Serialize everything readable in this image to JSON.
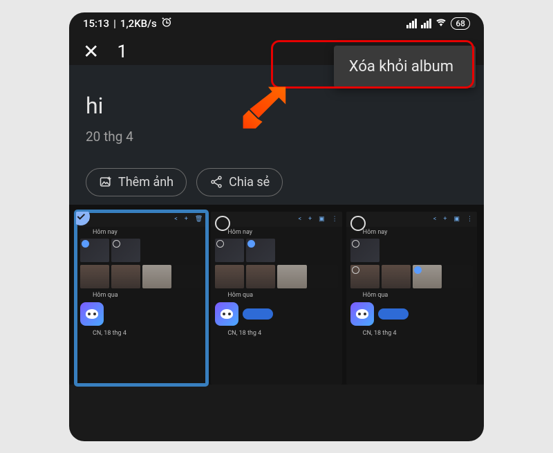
{
  "status": {
    "time": "15:13",
    "net_speed": "1,2KB/s",
    "battery": "68"
  },
  "selection": {
    "count": "1"
  },
  "menu": {
    "remove_from_album": "Xóa khỏi album"
  },
  "album": {
    "title": "hi",
    "date": "20 thg 4",
    "add_photo_label": "Thêm ảnh",
    "share_label": "Chia sẻ"
  },
  "thumbs": {
    "groups": {
      "today": "Hôm nay",
      "yesterday": "Hôm qua",
      "sun_apr18": "CN, 18 thg 4"
    },
    "item1": {
      "selected": true,
      "topbar_left": "✕  1"
    },
    "item2": {
      "selected": false
    },
    "item3": {
      "selected": false
    }
  }
}
